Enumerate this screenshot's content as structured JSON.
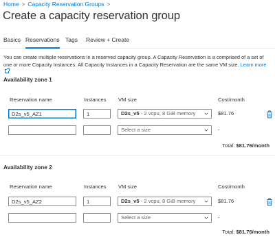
{
  "breadcrumb": {
    "items": [
      "Home",
      "Capacity Reservation Groups"
    ],
    "separator": ">"
  },
  "page": {
    "title": "Create a capacity reservation group"
  },
  "tabs": [
    {
      "label": "Basics",
      "active": false
    },
    {
      "label": "Reservations",
      "active": true
    },
    {
      "label": "Tags",
      "active": false
    },
    {
      "label": "Review + Create",
      "active": false
    }
  ],
  "description": {
    "text": "You can create multiple reservations in a reserved capacity group. A Capacity Reservation is a comprised of a set of one or more Capacity Instances. All Capacity Instances in a Capacity Reservation are the same VM size.",
    "learn_more": "Learn more"
  },
  "columns": {
    "name": "Reservation name",
    "instances": "Instances",
    "vm_size": "VM size",
    "cost": "Cost/month"
  },
  "zones": [
    {
      "title": "Availability zone 1",
      "rows": [
        {
          "name": "D2s_v5_AZ1",
          "instances": "1",
          "size_name": "D2s_v5",
          "size_detail": " - 2 vcpu, 8 GiB memory",
          "cost": "$81.76",
          "has_delete": true
        },
        {
          "name": "",
          "instances": "",
          "size_placeholder": "Select a size",
          "cost": "-",
          "has_delete": false
        }
      ],
      "total_label": "Total:",
      "total_value": "$81.76/month"
    },
    {
      "title": "Availability zone 2",
      "rows": [
        {
          "name": "D2s_v5_AZ2",
          "instances": "1",
          "size_name": "D2s_v5",
          "size_detail": " - 2 vcpu, 8 GiB memory",
          "cost": "$81.76",
          "has_delete": true
        },
        {
          "name": "",
          "instances": "",
          "size_placeholder": "Select a size",
          "cost": "-",
          "has_delete": false
        }
      ],
      "total_label": "Total:",
      "total_value": "$81.76/month"
    }
  ],
  "icons": {
    "chevron": "chevron-down-icon",
    "delete": "trash-icon",
    "external": "external-link-icon"
  },
  "colors": {
    "accent": "#0078d4",
    "text": "#323130",
    "border": "#8a8886"
  }
}
